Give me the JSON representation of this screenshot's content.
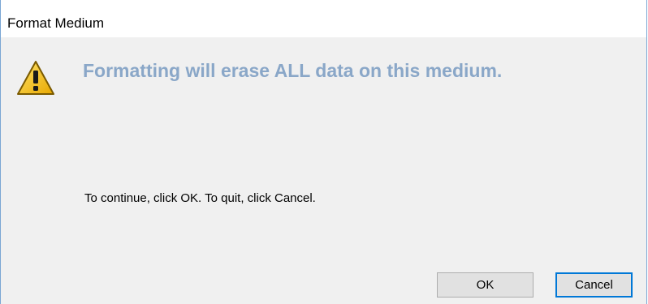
{
  "window": {
    "title": "Format Medium"
  },
  "dialog": {
    "icon": "warning-icon",
    "headline": "Formatting will erase ALL data on this medium.",
    "headline_color": "#8aa7c8",
    "message": "To continue, click OK. To quit, click Cancel.",
    "buttons": {
      "ok_label": "OK",
      "cancel_label": "Cancel",
      "default_button": "Cancel"
    }
  },
  "colors": {
    "accent": "#0078d7",
    "warning_yellow": "#f2c200"
  }
}
